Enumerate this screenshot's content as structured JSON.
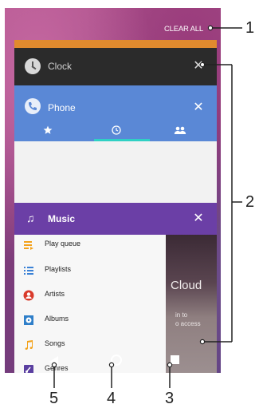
{
  "recents": {
    "clear_all_label": "CLEAR ALL",
    "cards": {
      "clock": {
        "title": "Clock",
        "close_glyph": "✕"
      },
      "phone": {
        "title": "Phone",
        "close_glyph": "✕",
        "tabs": [
          "favorites-star-icon",
          "recents-clock-icon",
          "contacts-people-icon"
        ]
      },
      "music": {
        "title": "Music",
        "close_glyph": "✕",
        "drawer_items": [
          {
            "label": "Play queue",
            "icon": "play-queue-icon",
            "color": "#f3a21b"
          },
          {
            "label": "Playlists",
            "icon": "playlists-icon",
            "color": "#3b82d6"
          },
          {
            "label": "Artists",
            "icon": "artists-icon",
            "color": "#d93a2b"
          },
          {
            "label": "Albums",
            "icon": "albums-icon",
            "color": "#2f7fc9"
          },
          {
            "label": "Songs",
            "icon": "songs-icon",
            "color": "#f3a21b"
          },
          {
            "label": "Genres",
            "icon": "genres-icon",
            "color": "#5a3fa0"
          }
        ],
        "side_title": "Cloud",
        "side_lines": [
          "in to",
          "o access"
        ]
      }
    }
  },
  "callouts": {
    "clear_all": "1",
    "cards_group": "2",
    "recent_apps_key": "3",
    "home_key": "4",
    "back_key": "5"
  },
  "colors": {
    "clock_bar": "#2b2b2b",
    "phone_bar": "#5a88d6",
    "music_bar": "#6b3fa6",
    "orange_card": "#e08a2e",
    "phone_tab_indicator": "#2fd0c4"
  }
}
